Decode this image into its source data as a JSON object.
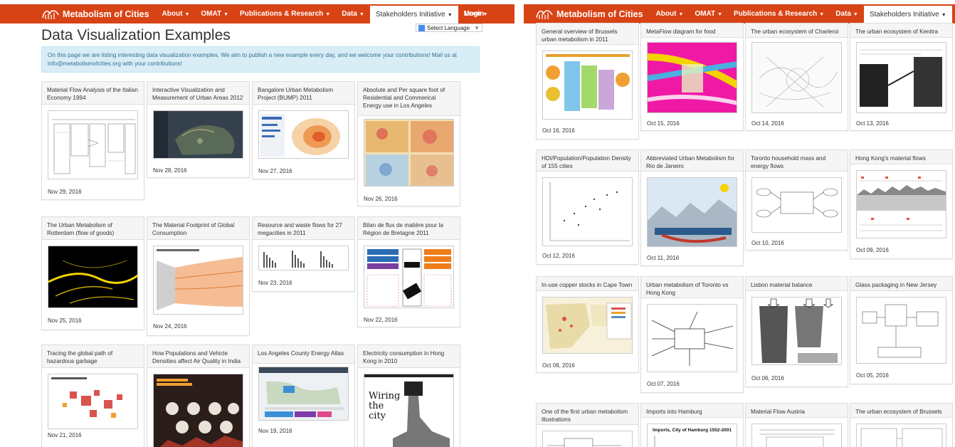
{
  "site": {
    "brand": "Metabolism of Cities",
    "nav": [
      {
        "label": "About",
        "dropdown": true
      },
      {
        "label": "OMAT",
        "dropdown": true
      },
      {
        "label": "Publications & Research",
        "dropdown": true
      },
      {
        "label": "Data",
        "dropdown": true
      },
      {
        "label": "Stakeholders Initiative",
        "dropdown": true,
        "active": true
      },
      {
        "label": "More",
        "dropdown": true
      }
    ],
    "login": "Login",
    "accent": "#d84315"
  },
  "page": {
    "title": "Data Visualization Examples",
    "language": "Select Language",
    "intro": "On this page we are listing interesting data visualization examples. We aim to publish a new example every day, and we welcome your contributions! Mail us at info@metabolismofcities.org with your contributions!"
  },
  "left_cards": [
    {
      "title": "Material Flow Analysis of the Italian Economy 1994",
      "date": "Nov 29, 2016"
    },
    {
      "title": "Interactive Visualization and Measurement of Urban Areas 2012",
      "date": "Nov 28, 2016"
    },
    {
      "title": "Bangalore Urban Metabolism Project (BUMP) 2011",
      "date": "Nov 27, 2016"
    },
    {
      "title": "Absolute and Per square foot of Residential and Commerical Energy use in Los Angeles",
      "date": "Nov 26, 2016"
    },
    {
      "title": "The Urban Metabolism of Rotterdam (flow of goods)",
      "date": "Nov 25, 2016"
    },
    {
      "title": "The Material Footprint of Global Consumption",
      "date": "Nov 24, 2016"
    },
    {
      "title": "Resource and waste flows for 27 megacities in 2011",
      "date": "Nov 23, 2016"
    },
    {
      "title": "Bilan de flux de matière pour la Région de Bretagne 2011",
      "date": "Nov 22, 2016"
    },
    {
      "title": "Tracing the global path of hazardous garbage",
      "date": "Nov 21, 2016"
    },
    {
      "title": "How Populations and Vehicle Densities affect Air Quality in India",
      "date": ""
    },
    {
      "title": "Los Angeles County Energy Atlas",
      "date": "Nov 19, 2016"
    },
    {
      "title": "Electricity consumption in Hong Kong in 2010",
      "date": ""
    }
  ],
  "right_cards": [
    {
      "title": "General overview of Brussels urban metabolism in 2011",
      "date": "Oct 16, 2016"
    },
    {
      "title": "MetaFlow diagram for food",
      "date": "Oct 15, 2016"
    },
    {
      "title": "The urban ecosystem of Charleroi",
      "date": "Oct 14, 2016"
    },
    {
      "title": "The urban ecosystem of Kenitra",
      "date": "Oct 13, 2016"
    },
    {
      "title": "HDI/Population/Population Density of 155 cities",
      "date": "Oct 12, 2016"
    },
    {
      "title": "Abbreviated Urban Metabolism for Rio de Janeiro",
      "date": "Oct 11, 2016"
    },
    {
      "title": "Toronto household mass and energy flows",
      "date": "Oct 10, 2016"
    },
    {
      "title": "Hong Kong's material flows",
      "date": "Oct 09, 2016"
    },
    {
      "title": "In-use copper stocks in Cape Town",
      "date": "Oct 08, 2016"
    },
    {
      "title": "Urban metabolism of Toronto vs Hong Kong",
      "date": "Oct 07, 2016"
    },
    {
      "title": "Lisbon material balance",
      "date": "Oct 06, 2016"
    },
    {
      "title": "Glass packaging in New Jersey",
      "date": "Oct 05, 2016"
    },
    {
      "title": "One of the first urban metabolism illustrations",
      "date": ""
    },
    {
      "title": "Imports into Hamburg",
      "date": ""
    },
    {
      "title": "Material Flow Austria",
      "date": ""
    },
    {
      "title": "The urban ecosystem of Brussels",
      "date": ""
    }
  ],
  "thumb_text": {
    "wiring": "Wiring the city",
    "hamburg": "Imports, City of Hamburg 1552-2001"
  }
}
